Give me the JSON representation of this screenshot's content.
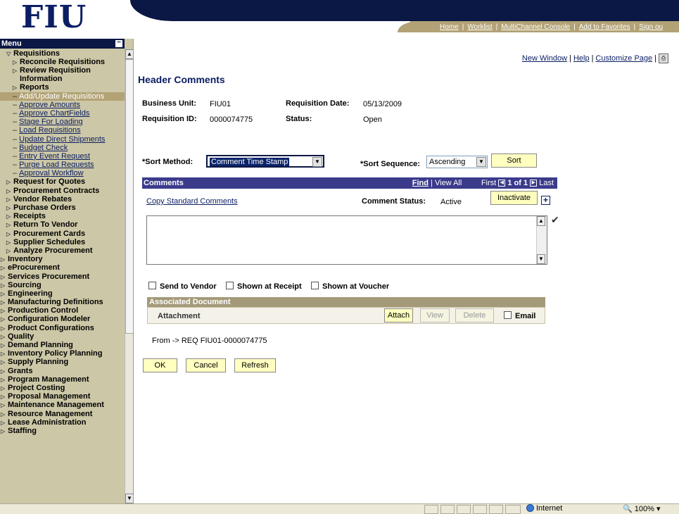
{
  "banner": {
    "logo": "FIU",
    "nav_links": [
      "Home",
      "Worklist",
      "MultiChannel Console",
      "Add to Favorites",
      "Sign ou"
    ]
  },
  "menu": {
    "title": "Menu",
    "collapse_icon": "minus-icon",
    "items": [
      {
        "label": "Requisitions",
        "level": 0,
        "type": "expanded"
      },
      {
        "label": "Reconcile Requisitions",
        "level": 1,
        "type": "folder"
      },
      {
        "label": "Review Requisition Information",
        "level": 1,
        "type": "folder"
      },
      {
        "label": "Reports",
        "level": 1,
        "type": "folder"
      },
      {
        "label": "Add/Update Requisitions",
        "level": 1,
        "type": "selected"
      },
      {
        "label": "Approve Amounts",
        "level": 1,
        "type": "leaf"
      },
      {
        "label": "Approve ChartFields",
        "level": 1,
        "type": "leaf"
      },
      {
        "label": "Stage For Loading",
        "level": 1,
        "type": "leaf"
      },
      {
        "label": "Load Requisitions",
        "level": 1,
        "type": "leaf"
      },
      {
        "label": "Update Direct Shipments",
        "level": 1,
        "type": "leaf"
      },
      {
        "label": "Budget Check",
        "level": 1,
        "type": "leaf"
      },
      {
        "label": "Entry Event Request",
        "level": 1,
        "type": "leaf"
      },
      {
        "label": "Purge Load Requests",
        "level": 1,
        "type": "leaf"
      },
      {
        "label": "Approval Workflow",
        "level": 1,
        "type": "leaf"
      },
      {
        "label": "Request for Quotes",
        "level": 0,
        "type": "folder"
      },
      {
        "label": "Procurement Contracts",
        "level": 0,
        "type": "folder"
      },
      {
        "label": "Vendor Rebates",
        "level": 0,
        "type": "folder"
      },
      {
        "label": "Purchase Orders",
        "level": 0,
        "type": "folder"
      },
      {
        "label": "Receipts",
        "level": 0,
        "type": "folder"
      },
      {
        "label": "Return To Vendor",
        "level": 0,
        "type": "folder"
      },
      {
        "label": "Procurement Cards",
        "level": 0,
        "type": "folder"
      },
      {
        "label": "Supplier Schedules",
        "level": 0,
        "type": "folder"
      },
      {
        "label": "Analyze Procurement",
        "level": 0,
        "type": "folder"
      },
      {
        "label": "Inventory",
        "level": -1,
        "type": "folder"
      },
      {
        "label": "eProcurement",
        "level": -1,
        "type": "folder"
      },
      {
        "label": "Services Procurement",
        "level": -1,
        "type": "folder"
      },
      {
        "label": "Sourcing",
        "level": -1,
        "type": "folder"
      },
      {
        "label": "Engineering",
        "level": -1,
        "type": "folder"
      },
      {
        "label": "Manufacturing Definitions",
        "level": -1,
        "type": "folder"
      },
      {
        "label": "Production Control",
        "level": -1,
        "type": "folder"
      },
      {
        "label": "Configuration Modeler",
        "level": -1,
        "type": "folder"
      },
      {
        "label": "Product Configurations",
        "level": -1,
        "type": "folder"
      },
      {
        "label": "Quality",
        "level": -1,
        "type": "folder"
      },
      {
        "label": "Demand Planning",
        "level": -1,
        "type": "folder"
      },
      {
        "label": "Inventory Policy Planning",
        "level": -1,
        "type": "folder"
      },
      {
        "label": "Supply Planning",
        "level": -1,
        "type": "folder"
      },
      {
        "label": "Grants",
        "level": -1,
        "type": "folder"
      },
      {
        "label": "Program Management",
        "level": -1,
        "type": "folder"
      },
      {
        "label": "Project Costing",
        "level": -1,
        "type": "folder"
      },
      {
        "label": "Proposal Management",
        "level": -1,
        "type": "folder"
      },
      {
        "label": "Maintenance Management",
        "level": -1,
        "type": "folder"
      },
      {
        "label": "Resource Management",
        "level": -1,
        "type": "folder"
      },
      {
        "label": "Lease Administration",
        "level": -1,
        "type": "folder"
      },
      {
        "label": "Staffing",
        "level": -1,
        "type": "folder"
      }
    ]
  },
  "top_links": {
    "new_window": "New Window",
    "help": "Help",
    "customize": "Customize Page",
    "http_icon": "http-icon"
  },
  "page": {
    "title": "Header Comments",
    "business_unit_label": "Business Unit:",
    "business_unit": "FIU01",
    "req_date_label": "Requisition Date:",
    "req_date": "05/13/2009",
    "req_id_label": "Requisition ID:",
    "req_id": "0000074775",
    "status_label": "Status:",
    "status": "Open",
    "sort_method_label": "*Sort Method:",
    "sort_method": "Comment Time Stamp",
    "sort_sequence_label": "*Sort Sequence:",
    "sort_sequence": "Ascending",
    "sort_button": "Sort"
  },
  "comments": {
    "header": "Comments",
    "find": "Find",
    "view_all": "View All",
    "first": "First",
    "page_of": "1 of 1",
    "last": "Last",
    "copy_standard": "Copy Standard Comments",
    "comment_status_label": "Comment Status:",
    "comment_status": "Active",
    "inactivate": "Inactivate",
    "comment_text": "",
    "send_to_vendor": "Send to Vendor",
    "shown_at_receipt": "Shown at Receipt",
    "shown_at_voucher": "Shown at Voucher"
  },
  "assoc": {
    "header": "Associated Document",
    "attachment": "Attachment",
    "attach": "Attach",
    "view": "View",
    "delete": "Delete",
    "email": "Email"
  },
  "footer": {
    "from_text": "From -> REQ FIU01-0000074775",
    "ok": "OK",
    "cancel": "Cancel",
    "refresh": "Refresh"
  },
  "statusbar": {
    "zone": "Internet",
    "zoom": "100%"
  }
}
